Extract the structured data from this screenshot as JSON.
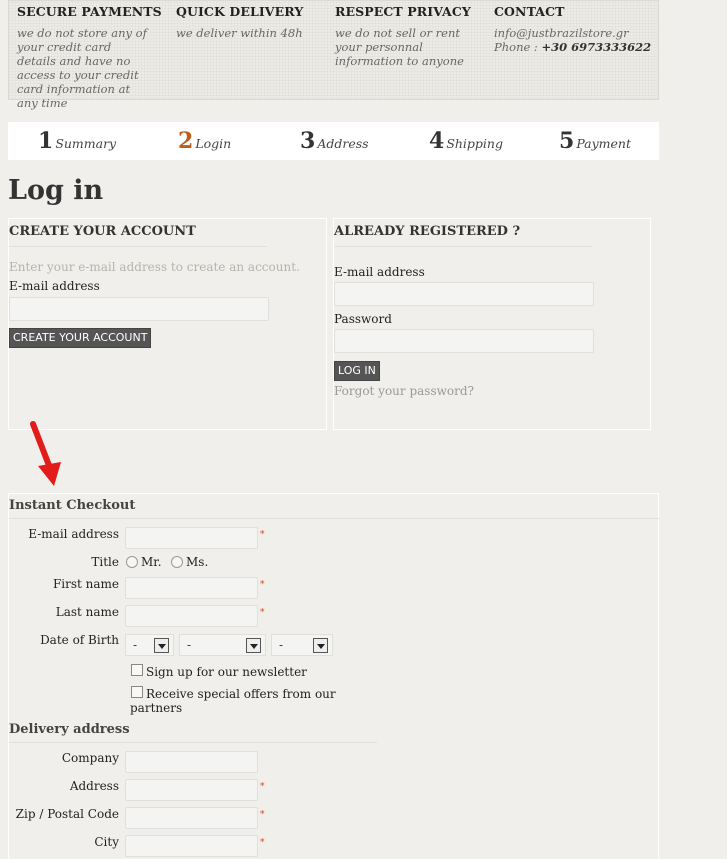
{
  "info_banner": [
    {
      "title": "SECURE PAYMENTS",
      "text": "we do not store any of your credit card details and have no access to your credit card information at any time"
    },
    {
      "title": "QUICK DELIVERY",
      "text": "we deliver within 48h"
    },
    {
      "title": "RESPECT PRIVACY",
      "text": "we do not sell or rent your personnal information to anyone"
    },
    {
      "title": "CONTACT",
      "email": "info@justbrazilstore.gr",
      "phone_label": "Phone :",
      "phone": "+30 6973333622"
    }
  ],
  "steps": [
    {
      "num": "1",
      "label": "Summary"
    },
    {
      "num": "2",
      "label": "Login"
    },
    {
      "num": "3",
      "label": "Address"
    },
    {
      "num": "4",
      "label": "Shipping"
    },
    {
      "num": "5",
      "label": "Payment"
    }
  ],
  "page_title": "Log in",
  "create_account": {
    "title": "CREATE YOUR ACCOUNT",
    "hint": "Enter your e-mail address to create an account.",
    "email_label": "E-mail address",
    "email_value": "",
    "button": "CREATE YOUR ACCOUNT"
  },
  "already_registered": {
    "title": "ALREADY REGISTERED ?",
    "email_label": "E-mail address",
    "email_value": "",
    "password_label": "Password",
    "password_value": "",
    "button": "LOG IN",
    "forgot": "Forgot your password?"
  },
  "instant_checkout": {
    "title": "Instant Checkout",
    "required_mark": "*",
    "email_label": "E-mail address",
    "title_label": "Title",
    "title_options": [
      "Mr.",
      "Ms."
    ],
    "first_name_label": "First name",
    "last_name_label": "Last name",
    "dob_label": "Date of Birth",
    "dob_day": "-",
    "dob_month": "-",
    "dob_year": "-",
    "newsletter_label": "Sign up for our newsletter",
    "offers_label_1": "Receive special offers from our",
    "offers_label_2": "partners"
  },
  "delivery": {
    "title": "Delivery address",
    "company_label": "Company",
    "address_label": "Address",
    "zip_label": "Zip / Postal Code",
    "city_label": "City"
  },
  "colors": {
    "accent": "#c05a1b",
    "required": "#d44a1a",
    "button": "#555555",
    "arrow": "#e21b1b"
  }
}
